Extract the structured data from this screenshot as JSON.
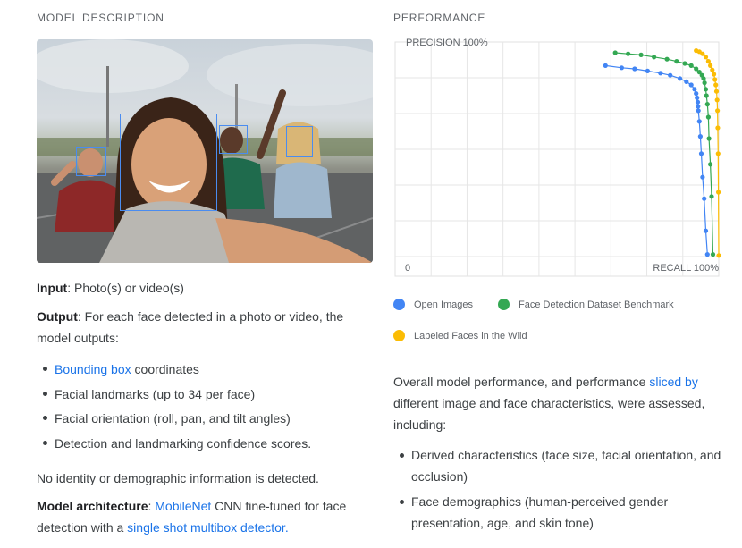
{
  "left": {
    "title": "MODEL DESCRIPTION",
    "input_label": "Input",
    "input_text": ": Photo(s) or video(s)",
    "output_label": "Output",
    "output_text": ": For each face detected in a photo or video, the model outputs:",
    "bullets": [
      {
        "link": "Bounding box",
        "text": " coordinates"
      },
      {
        "text": "Facial landmarks (up to 34 per face)"
      },
      {
        "text": "Facial orientation (roll, pan, and tilt angles)"
      },
      {
        "text": "Detection and landmarking confidence scores."
      }
    ],
    "no_identity": "No identity or demographic information is detected.",
    "arch_label": "Model architecture",
    "arch_sep": ": ",
    "arch_link1": "MobileNet",
    "arch_text": " CNN fine-tuned for face detection with a ",
    "arch_link2": "single shot multibox detector."
  },
  "right": {
    "title": "PERFORMANCE",
    "perf_text1": "Overall model performance, and performance ",
    "perf_link": "sliced by",
    "perf_text2": " different image and face characteristics, were assessed, including:",
    "bullets": [
      "Derived characteristics (face size, facial orientation, and occlusion)",
      "Face demographics (human-perceived gender presentation, age, and skin tone)"
    ]
  },
  "icons": {
    "photo": "group-selfie-photo"
  },
  "chart_data": {
    "type": "scatter",
    "title": "",
    "xlabel": "RECALL 100%",
    "ylabel": "PRECISION 100%",
    "origin_label": "0",
    "xlim": [
      0,
      100
    ],
    "ylim": [
      0,
      100
    ],
    "grid": true,
    "legend_position": "bottom",
    "series": [
      {
        "name": "Open Images",
        "color": "#4285f4",
        "x": [
          65,
          70,
          74,
          78,
          82,
          85,
          88,
          90,
          91.5,
          92.5,
          93,
          93.3,
          93.5,
          93.6,
          93.7,
          94,
          94.3,
          94.6,
          95,
          95.5,
          96,
          96.5
        ],
        "y": [
          89,
          88,
          87.5,
          86.5,
          85.5,
          84.5,
          83,
          81.5,
          80,
          78,
          76,
          74,
          72,
          70,
          68,
          63,
          56,
          48,
          37,
          27,
          12,
          1
        ]
      },
      {
        "name": "Face Detection Dataset Benchmark",
        "color": "#34a853",
        "x": [
          68,
          72,
          76,
          80,
          84,
          87,
          89.5,
          91.5,
          93,
          94,
          94.8,
          95.3,
          95.6,
          96,
          96.2,
          96.5,
          96.8,
          97,
          97.4,
          97.8,
          98.2
        ],
        "y": [
          95,
          94.5,
          94,
          93,
          92,
          91,
          90,
          89,
          87.5,
          86,
          84.5,
          83,
          81,
          78,
          75,
          71,
          65,
          55,
          43,
          28,
          1
        ]
      },
      {
        "name": "Labeled Faces in the Wild",
        "color": "#fbbc04",
        "x": [
          93,
          94,
          95,
          96,
          96.8,
          97.4,
          98,
          98.5,
          98.8,
          99.1,
          99.3,
          99.5,
          99.6,
          99.7,
          99.8,
          99.9,
          100
        ],
        "y": [
          96,
          95.5,
          94.5,
          93,
          91,
          89,
          87,
          85,
          82.5,
          80,
          77,
          73,
          68,
          60,
          48,
          30,
          0.5
        ]
      }
    ]
  }
}
